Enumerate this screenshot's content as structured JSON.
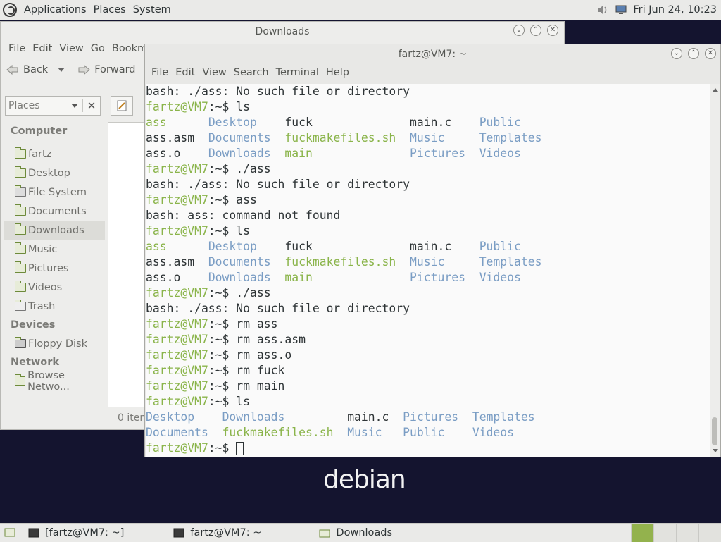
{
  "top_panel": {
    "menus": [
      "Applications",
      "Places",
      "System"
    ],
    "clock": "Fri Jun 24, 10:23"
  },
  "file_manager": {
    "title": "Downloads",
    "menus": [
      "File",
      "Edit",
      "View",
      "Go",
      "Bookm"
    ],
    "toolbar": {
      "back": "Back",
      "forward": "Forward"
    },
    "places_label": "Places",
    "sidebar": {
      "computer_heading": "Computer",
      "computer_items": [
        "fartz",
        "Desktop",
        "File System",
        "Documents",
        "Downloads",
        "Music",
        "Pictures",
        "Videos",
        "Trash"
      ],
      "selected": "Downloads",
      "devices_heading": "Devices",
      "devices_items": [
        "Floppy Disk"
      ],
      "network_heading": "Network",
      "network_items": [
        "Browse Netwo..."
      ]
    },
    "status": "0 item"
  },
  "terminal": {
    "title": "fartz@VM7: ~",
    "menus": [
      "File",
      "Edit",
      "View",
      "Search",
      "Terminal",
      "Help"
    ],
    "prompt_user": "fartz@VM7",
    "prompt_suffix": ":~$ ",
    "lines": [
      {
        "type": "out",
        "text": "bash: ./ass: No such file or directory"
      },
      {
        "type": "cmd",
        "text": "ls"
      },
      {
        "type": "ls",
        "cols": [
          [
            {
              "t": "ass",
              "c": "e"
            },
            {
              "t": "Desktop",
              "c": "d"
            },
            {
              "t": "fuck",
              "c": "f"
            },
            {
              "t": "main.c",
              "c": "f"
            },
            {
              "t": "Public",
              "c": "d"
            }
          ]
        ]
      },
      {
        "type": "ls",
        "cols": [
          [
            {
              "t": "ass.asm",
              "c": "f"
            },
            {
              "t": "Documents",
              "c": "d"
            },
            {
              "t": "fuckmakefiles.sh",
              "c": "e"
            },
            {
              "t": "Music",
              "c": "d"
            },
            {
              "t": "Templates",
              "c": "d"
            }
          ]
        ]
      },
      {
        "type": "ls",
        "cols": [
          [
            {
              "t": "ass.o",
              "c": "f"
            },
            {
              "t": "Downloads",
              "c": "d"
            },
            {
              "t": "main",
              "c": "e"
            },
            {
              "t": "Pictures",
              "c": "d"
            },
            {
              "t": "Videos",
              "c": "d"
            }
          ]
        ]
      },
      {
        "type": "cmd",
        "text": "./ass"
      },
      {
        "type": "out",
        "text": "bash: ./ass: No such file or directory"
      },
      {
        "type": "cmd",
        "text": "ass"
      },
      {
        "type": "out",
        "text": "bash: ass: command not found"
      },
      {
        "type": "cmd",
        "text": "ls"
      },
      {
        "type": "ls",
        "cols": [
          [
            {
              "t": "ass",
              "c": "e"
            },
            {
              "t": "Desktop",
              "c": "d"
            },
            {
              "t": "fuck",
              "c": "f"
            },
            {
              "t": "main.c",
              "c": "f"
            },
            {
              "t": "Public",
              "c": "d"
            }
          ]
        ]
      },
      {
        "type": "ls",
        "cols": [
          [
            {
              "t": "ass.asm",
              "c": "f"
            },
            {
              "t": "Documents",
              "c": "d"
            },
            {
              "t": "fuckmakefiles.sh",
              "c": "e"
            },
            {
              "t": "Music",
              "c": "d"
            },
            {
              "t": "Templates",
              "c": "d"
            }
          ]
        ]
      },
      {
        "type": "ls",
        "cols": [
          [
            {
              "t": "ass.o",
              "c": "f"
            },
            {
              "t": "Downloads",
              "c": "d"
            },
            {
              "t": "main",
              "c": "e"
            },
            {
              "t": "Pictures",
              "c": "d"
            },
            {
              "t": "Videos",
              "c": "d"
            }
          ]
        ]
      },
      {
        "type": "cmd",
        "text": "./ass"
      },
      {
        "type": "out",
        "text": "bash: ./ass: No such file or directory"
      },
      {
        "type": "cmd",
        "text": "rm ass"
      },
      {
        "type": "cmd",
        "text": "rm ass.asm"
      },
      {
        "type": "cmd",
        "text": "rm ass.o"
      },
      {
        "type": "cmd",
        "text": "rm fuck"
      },
      {
        "type": "cmd",
        "text": "rm main"
      },
      {
        "type": "cmd",
        "text": "ls"
      },
      {
        "type": "ls2",
        "cols": [
          [
            {
              "t": "Desktop",
              "c": "d"
            },
            {
              "t": "Downloads",
              "c": "d"
            },
            {
              "t": "main.c",
              "c": "f"
            },
            {
              "t": "Pictures",
              "c": "d"
            },
            {
              "t": "Templates",
              "c": "d"
            }
          ]
        ]
      },
      {
        "type": "ls2",
        "cols": [
          [
            {
              "t": "Documents",
              "c": "d"
            },
            {
              "t": "fuckmakefiles.sh",
              "c": "e"
            },
            {
              "t": "Music",
              "c": "d"
            },
            {
              "t": "Public",
              "c": "d"
            },
            {
              "t": "Videos",
              "c": "d"
            }
          ]
        ]
      },
      {
        "type": "cmd",
        "text": "",
        "cursor": true
      }
    ]
  },
  "desktop": {
    "logo_text": "debian"
  },
  "taskbar": {
    "tasks": [
      "[fartz@VM7: ~]",
      "fartz@VM7: ~",
      "Downloads"
    ]
  }
}
